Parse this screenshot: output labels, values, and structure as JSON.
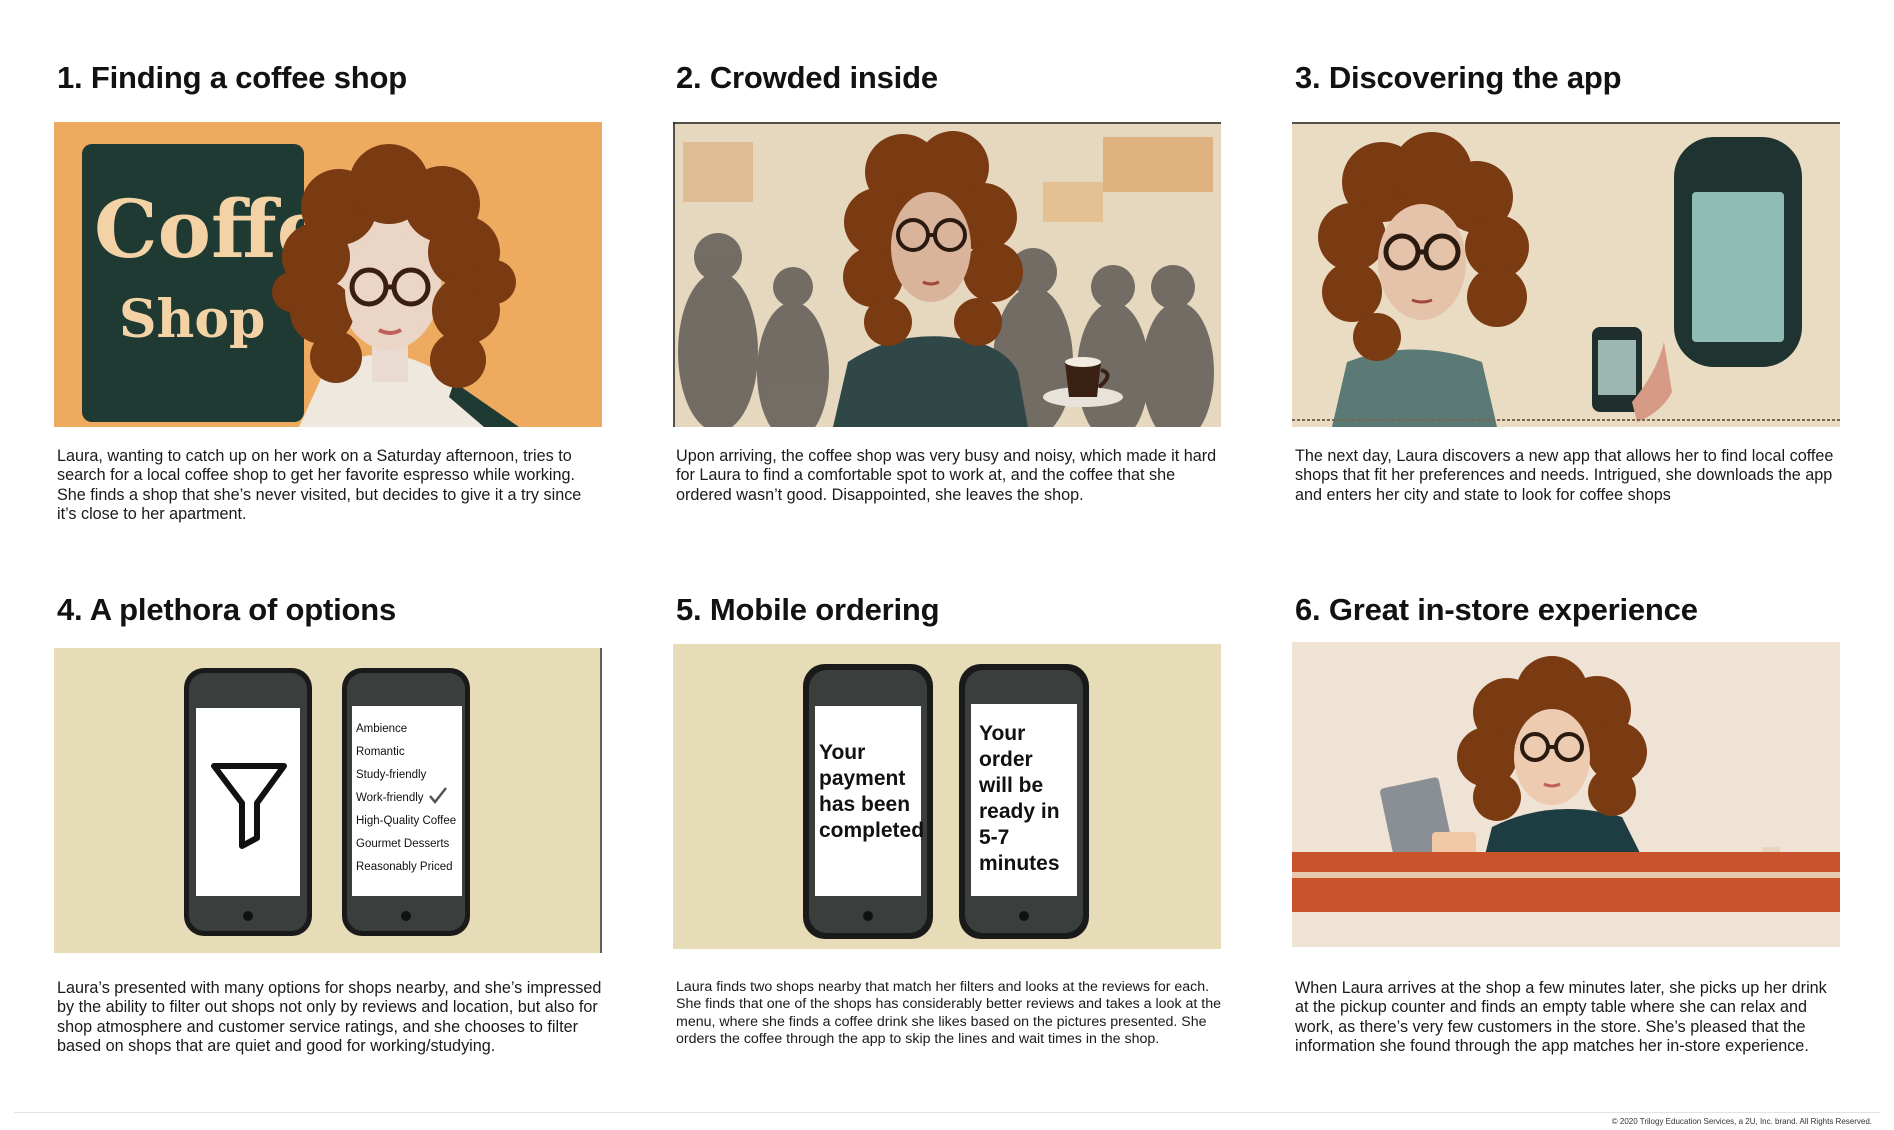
{
  "panels": [
    {
      "title": "1. Finding a coffee shop",
      "caption": "Laura, wanting to catch up on her work on a Saturday afternoon, tries to search for a local coffee shop to get her favorite espresso while working. She finds a shop that she’s never visited, but decides to give it a try since it’s close to her apartment.",
      "sign_line1": "Coffe",
      "sign_line2": "Shop"
    },
    {
      "title": "2. Crowded inside",
      "caption": "Upon arriving, the coffee shop was very busy and noisy, which made it hard for Laura to find a comfortable spot to work at, and the coffee that she ordered wasn’t good. Disappointed, she leaves the shop."
    },
    {
      "title": "3. Discovering the app",
      "caption": "The next day, Laura discovers a new app that allows her to find local coffee shops that fit her preferences and needs. Intrigued, she downloads the app and enters her city and state to look for coffee shops"
    },
    {
      "title": "4. A plethora of options",
      "caption": "Laura’s presented with many options for shops nearby, and she’s impressed by the ability to filter out shops not only by reviews and location, but also for shop atmosphere and customer service ratings, and she chooses to filter based on shops that are quiet and good for working/studying.",
      "filter_options": [
        "Ambience",
        "Romantic",
        "Study-friendly",
        "Work-friendly",
        "High-Quality Coffee",
        "Gourmet Desserts",
        "Reasonably Priced"
      ],
      "checked_option": "Work-friendly"
    },
    {
      "title": "5. Mobile ordering",
      "caption": "Laura finds two shops nearby that match her filters and looks at the reviews for each. She finds that one of the shops has considerably better reviews and takes a look at the menu, where she finds a coffee drink she likes based on the pictures presented. She orders the coffee through the app to skip the lines and wait times in the shop.",
      "phone1_lines": [
        "Your",
        "payment",
        "has been",
        "completed"
      ],
      "phone2_lines": [
        "Your",
        "order",
        "will be",
        "ready in",
        "5-7",
        "minutes"
      ]
    },
    {
      "title": "6. Great in-store experience",
      "caption": "When Laura arrives at the shop a few minutes later, she picks up her drink at the pickup counter and finds an empty table where she can relax and work, as there’s very few customers in the store. She’s pleased that the information she found through the app matches her in-store experience."
    }
  ],
  "footer": {
    "copyright": "© 2020 Trilogy Education Services, a 2U, Inc. brand. All Rights Reserved."
  },
  "colors": {
    "hair": "#7a3a12",
    "panel1_bg": "#f2b065",
    "sign_green": "#1f3a33",
    "sign_text": "#f3d2a6",
    "phone_bg": "#e6ddb8",
    "counter": "#c9532a"
  }
}
